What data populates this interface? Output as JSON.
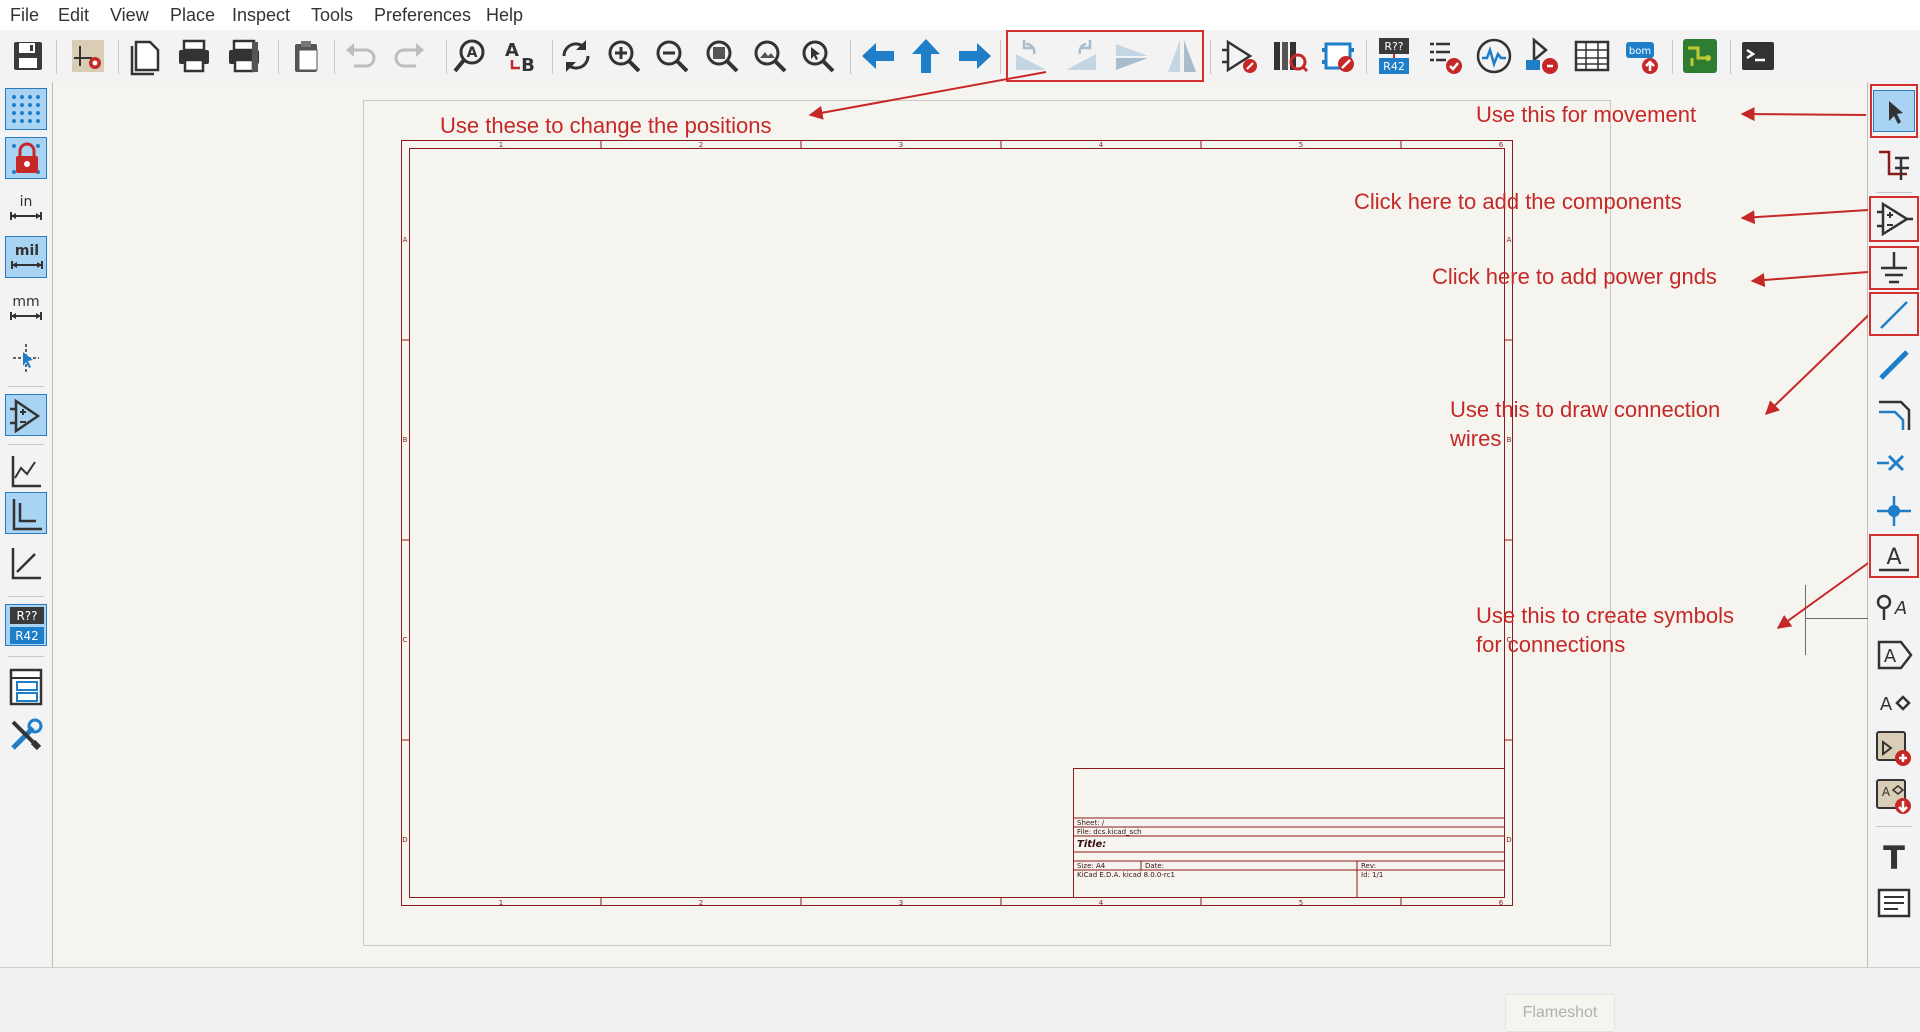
{
  "menu": [
    "File",
    "Edit",
    "View",
    "Place",
    "Inspect",
    "Tools",
    "Preferences",
    "Help"
  ],
  "toolbar": {
    "buttons": [
      "save-icon",
      "board-setup-icon",
      "new-page-icon",
      "print-icon",
      "plot-icon",
      "paste-icon",
      "undo-icon",
      "redo-icon",
      "find-icon",
      "find-replace-icon",
      "refresh-icon",
      "zoom-in-icon",
      "zoom-out-icon",
      "zoom-fit-icon",
      "zoom-objects-icon",
      "zoom-tool-icon",
      "navigate-back-icon",
      "navigate-up-icon",
      "navigate-forward-icon",
      "rotate-ccw-icon",
      "rotate-cw-icon",
      "mirror-horizontal-icon",
      "mirror-vertical-icon",
      "symbol-editor-icon",
      "symbol-library-icon",
      "footprint-assign-icon",
      "annotate-icon",
      "erc-icon",
      "simulator-icon",
      "bus-alias-icon",
      "bom-table-icon",
      "bom-export-icon",
      "pcb-editor-icon",
      "scripting-console-icon"
    ],
    "annotate_label_top": "R??",
    "annotate_label_bottom": "R42",
    "bom_label": "bom"
  },
  "left_toolbar": {
    "units": {
      "in": "in",
      "mil": "mil",
      "mm": "mm"
    },
    "annotate_top": "R??",
    "annotate_bottom": "R42"
  },
  "sheet": {
    "columns": [
      "1",
      "2",
      "3",
      "4",
      "5",
      "6"
    ],
    "rows": [
      "A",
      "B",
      "C",
      "D"
    ],
    "title_block": {
      "sheet": "Sheet: /",
      "file": "File: dcs.kicad_sch",
      "title": "Title:",
      "size": "Size: A4",
      "date": "Date:",
      "rev": "Rev:",
      "kicad": "KiCad E.D.A.  kicad 8.0.0-rc1",
      "id": "Id: 1/1"
    }
  },
  "annotations": {
    "positions": "Use these to change the positions",
    "movement": "Use this for movement",
    "components": "Click here to add the components",
    "power": "Click here to add power gnds",
    "wires_line1": "Use this to draw connection",
    "wires_line2": "wires",
    "symbols_line1": "Use this to create symbols",
    "symbols_line2": "for connections"
  },
  "right_toolbar": {
    "text_icon_label": "T",
    "label_A": "A"
  },
  "flameshot": "Flameshot",
  "colors": {
    "sheet_border": "#8b1a1a",
    "annotation_red": "#c62828",
    "icon_blue": "#1e7ec8",
    "active_bg": "#a9d3f3"
  }
}
